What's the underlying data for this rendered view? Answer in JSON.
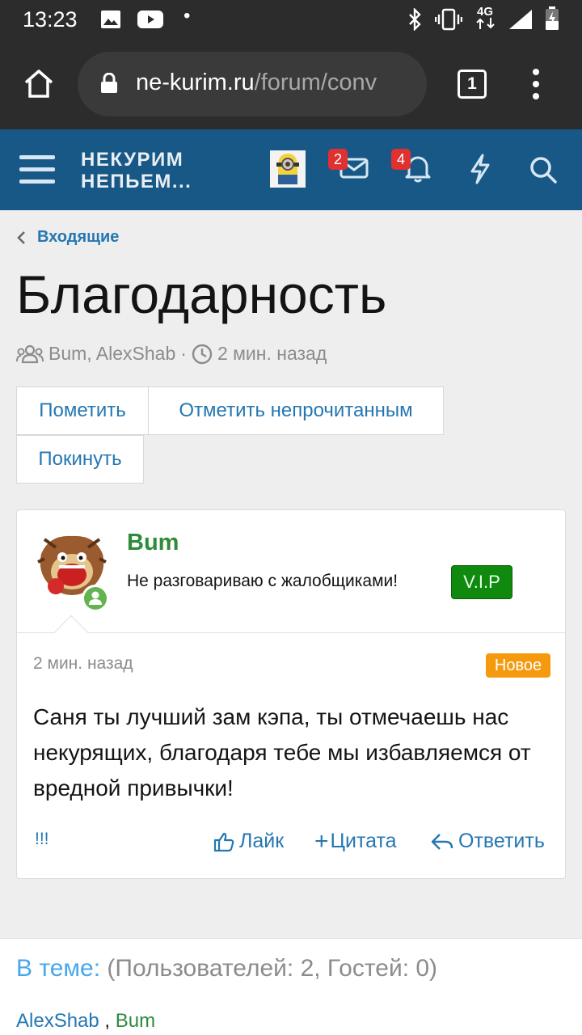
{
  "status_bar": {
    "time": "13:23",
    "dot": "•",
    "network": "4G"
  },
  "browser": {
    "url_domain": "ne-kurim.ru",
    "url_path": "/forum/conv",
    "tab_count": "1"
  },
  "site_header": {
    "logo_line1": "НЕКУРИМ",
    "logo_line2": "НЕПЬЕМ...",
    "messages_badge": "2",
    "alerts_badge": "4"
  },
  "breadcrumb": {
    "label": "Входящие"
  },
  "conversation": {
    "title": "Благодарность",
    "participants": "Bum, AlexShab",
    "separator": "·",
    "time": "2 мин. назад"
  },
  "buttons": {
    "mark": "Пометить",
    "mark_unread": "Отметить непрочитанным",
    "leave": "Покинуть"
  },
  "message": {
    "author": "Bum",
    "user_title": "Не разговариваю с жалобщиками!",
    "user_badge": "V.I.P",
    "time": "2 мин. назад",
    "new_label": "Новое",
    "text": "Саня ты лучший зам кэпа, ты отмечаешь нас некурящих, благодаря тебе мы избавляемся от вредной привычки!",
    "report": "!!!",
    "like": "Лайк",
    "quote_plus": "+",
    "quote": "Цитата",
    "reply": "Ответить"
  },
  "online": {
    "label": "В теме:",
    "counts": "(Пользователей: 2, Гостей: 0)",
    "user1": "AlexShab",
    "sep": ",",
    "user2": "Bum"
  }
}
